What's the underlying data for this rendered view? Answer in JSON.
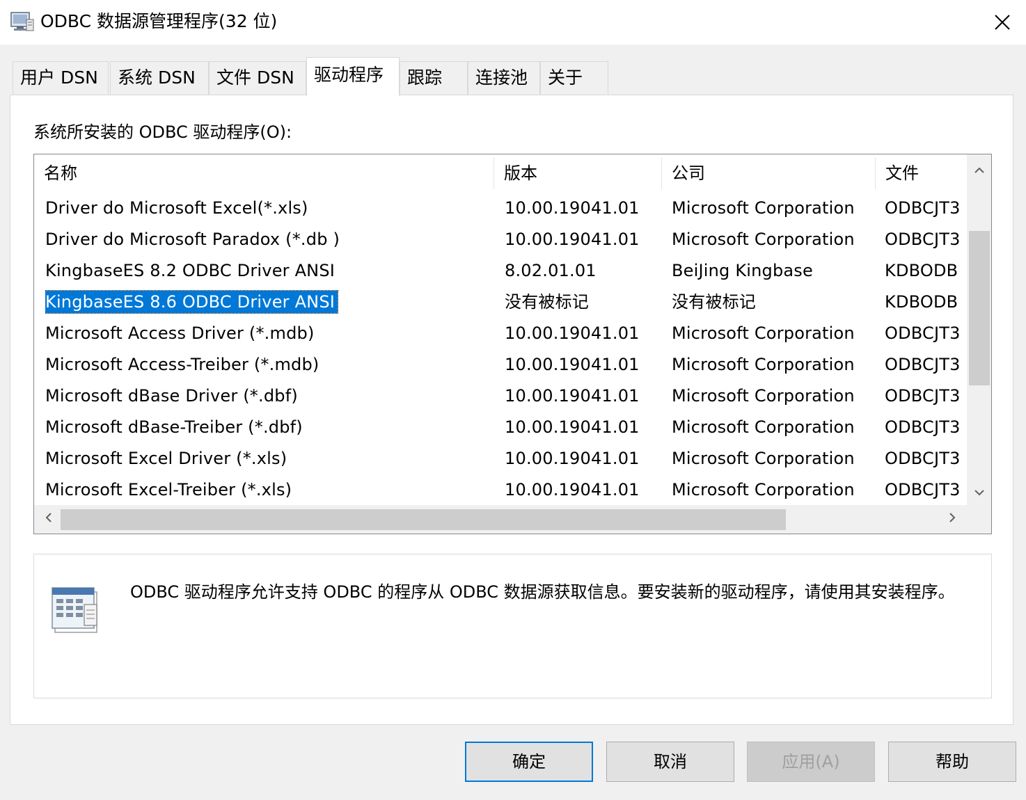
{
  "window": {
    "title": "ODBC 数据源管理程序(32 位)"
  },
  "tabs": [
    {
      "label": "用户 DSN"
    },
    {
      "label": "系统 DSN"
    },
    {
      "label": "文件 DSN"
    },
    {
      "label": "驱动程序"
    },
    {
      "label": "跟踪"
    },
    {
      "label": "连接池"
    },
    {
      "label": "关于"
    }
  ],
  "active_tab": "驱动程序",
  "drivers": {
    "label": "系统所安装的 ODBC 驱动程序(O):",
    "columns": [
      "名称",
      "版本",
      "公司",
      "文件"
    ],
    "rows": [
      {
        "name": "Driver do Microsoft Excel(*.xls)",
        "version": "10.00.19041.01",
        "company": "Microsoft Corporation",
        "file": "ODBCJT3"
      },
      {
        "name": "Driver do Microsoft Paradox (*.db )",
        "version": "10.00.19041.01",
        "company": "Microsoft Corporation",
        "file": "ODBCJT3"
      },
      {
        "name": "KingbaseES 8.2 ODBC Driver ANSI",
        "version": "8.02.01.01",
        "company": "BeiJing Kingbase",
        "file": "KDBODB"
      },
      {
        "name": "KingbaseES 8.6 ODBC Driver ANSI",
        "version": "没有被标记",
        "company": "没有被标记",
        "file": "KDBODB"
      },
      {
        "name": "Microsoft Access Driver (*.mdb)",
        "version": "10.00.19041.01",
        "company": "Microsoft Corporation",
        "file": "ODBCJT3"
      },
      {
        "name": "Microsoft Access-Treiber (*.mdb)",
        "version": "10.00.19041.01",
        "company": "Microsoft Corporation",
        "file": "ODBCJT3"
      },
      {
        "name": "Microsoft dBase Driver (*.dbf)",
        "version": "10.00.19041.01",
        "company": "Microsoft Corporation",
        "file": "ODBCJT3"
      },
      {
        "name": "Microsoft dBase-Treiber (*.dbf)",
        "version": "10.00.19041.01",
        "company": "Microsoft Corporation",
        "file": "ODBCJT3"
      },
      {
        "name": "Microsoft Excel Driver (*.xls)",
        "version": "10.00.19041.01",
        "company": "Microsoft Corporation",
        "file": "ODBCJT3"
      },
      {
        "name": "Microsoft Excel-Treiber (*.xls)",
        "version": "10.00.19041.01",
        "company": "Microsoft Corporation",
        "file": "ODBCJT3"
      }
    ],
    "selected_row": "KingbaseES 8.6 ODBC Driver ANSI"
  },
  "info": {
    "text": "ODBC 驱动程序允许支持 ODBC 的程序从 ODBC 数据源获取信息。要安装新的驱动程序，请使用其安装程序。",
    "icon": "odbc-driver-icon"
  },
  "buttons": {
    "ok": "确定",
    "cancel": "取消",
    "apply": "应用(A)",
    "help": "帮助"
  },
  "colors": {
    "selection": "#0078d7",
    "window_bg": "#f0f0f0",
    "panel_bg": "#ffffff"
  }
}
